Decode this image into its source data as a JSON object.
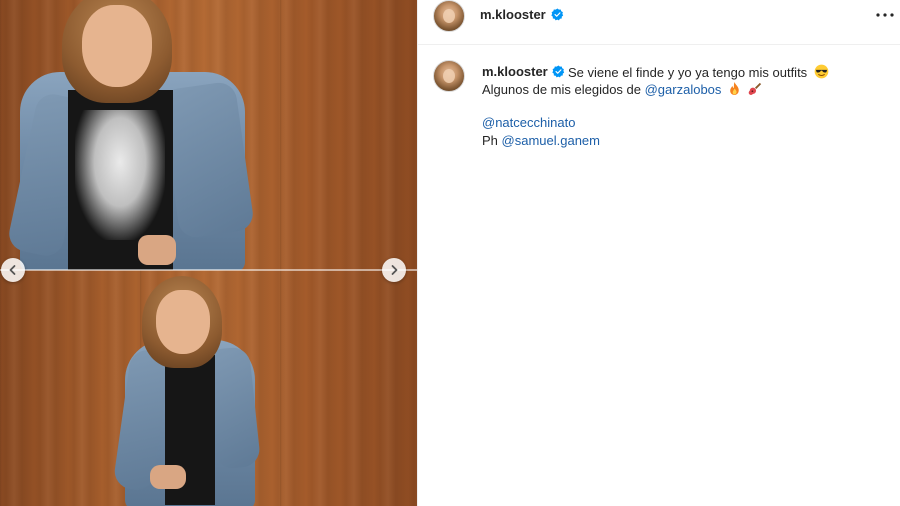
{
  "post": {
    "username": "m.klooster",
    "verified": true,
    "caption": {
      "line1": "Se viene el finde y yo ya tengo mis outfits",
      "line1_emoji": "sunglasses-face",
      "line2_prefix": "Algunos de mis elegidos de ",
      "line2_mention": "@garzalobos",
      "line2_emojis": [
        "fire",
        "guitar"
      ],
      "line3_mention": "@natcecchinato",
      "line4_prefix": "Ph ",
      "line4_mention": "@samuel.ganem"
    }
  },
  "media": {
    "photos": [
      "photo-1",
      "photo-2"
    ],
    "nav": {
      "prev_icon": "chevron-left-icon",
      "next_icon": "chevron-right-icon"
    }
  },
  "header": {
    "more_icon": "more-options-icon"
  },
  "colors": {
    "verified": "#0095f6",
    "mention": "#1d5fa8",
    "text": "#262626"
  }
}
